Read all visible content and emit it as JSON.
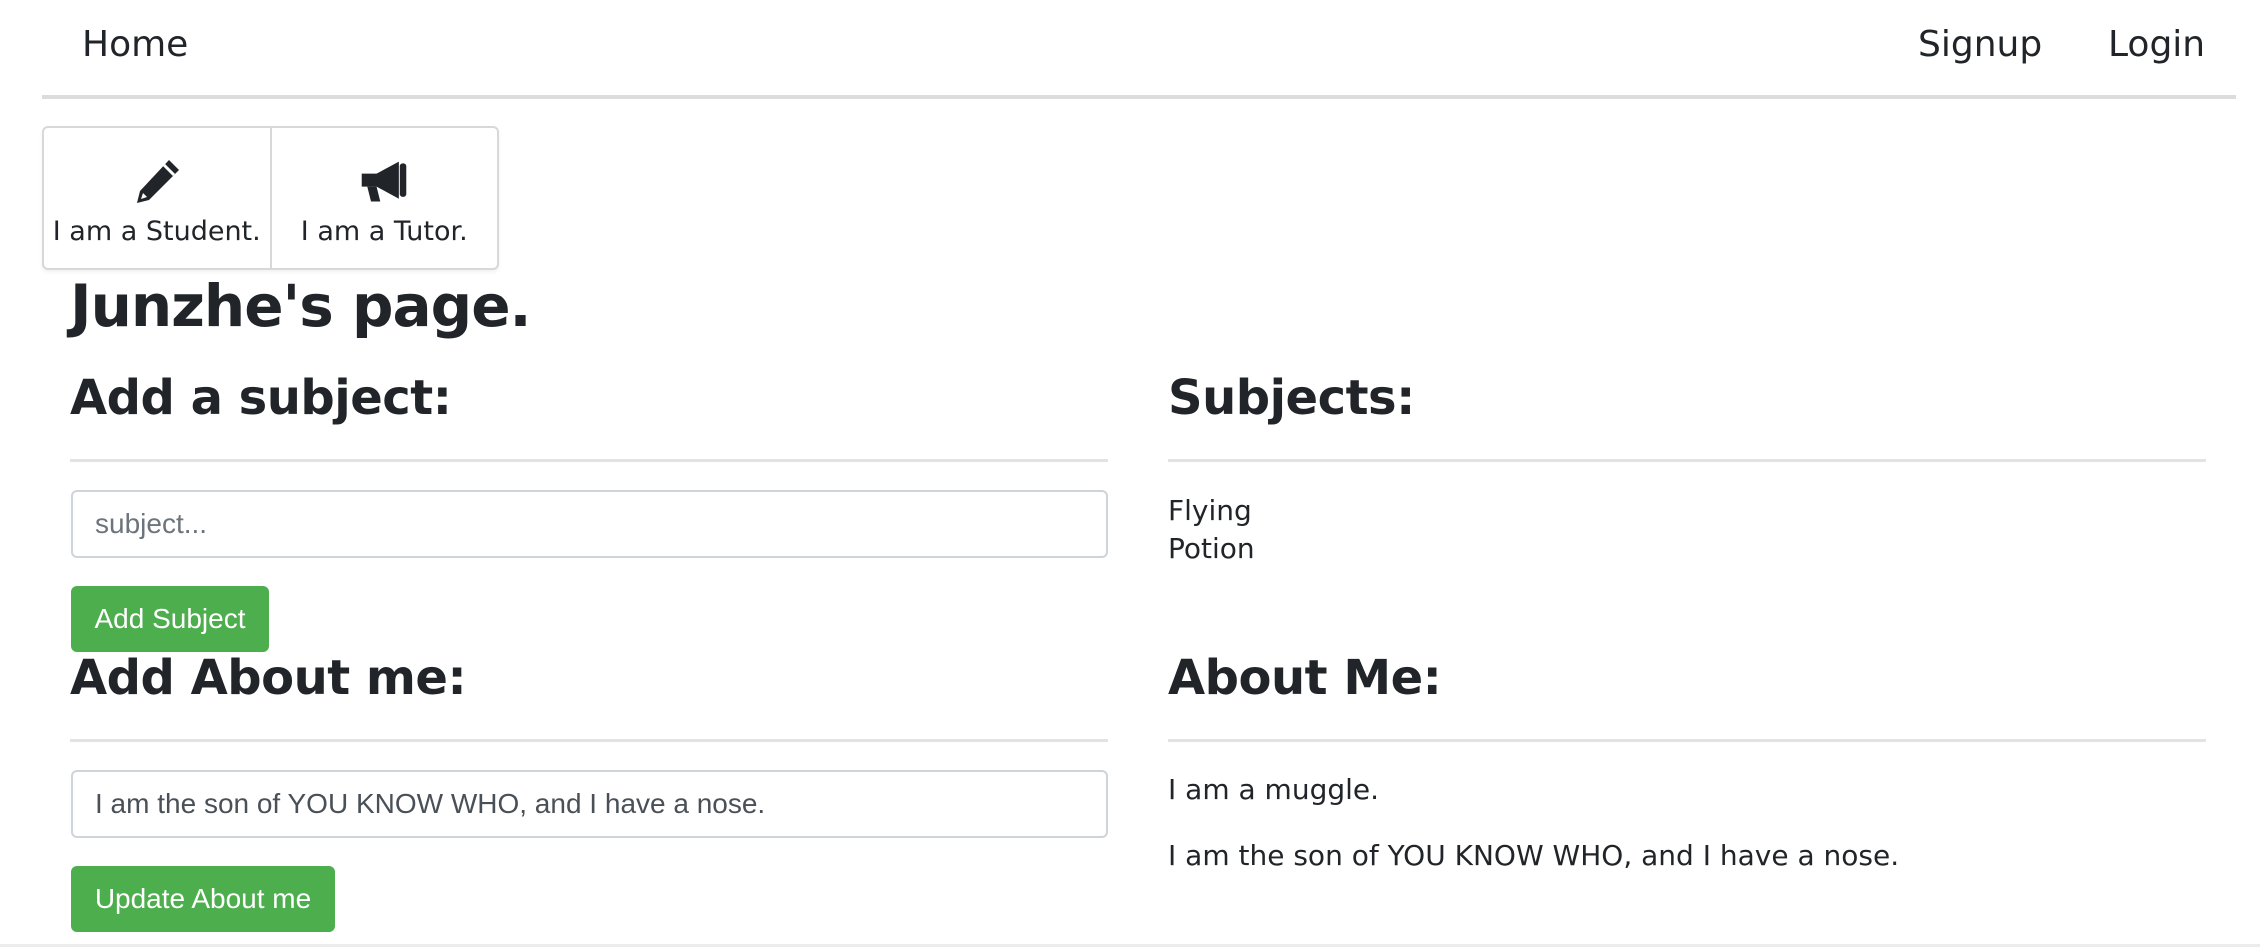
{
  "nav": {
    "home": "Home",
    "signup": "Signup",
    "login": "Login"
  },
  "roles": [
    {
      "label": "I am a Student.",
      "icon": "pencil-icon"
    },
    {
      "label": "I am a Tutor.",
      "icon": "megaphone-icon"
    }
  ],
  "page_title": "Junzhe's page.",
  "add_subject": {
    "heading": "Add a subject:",
    "placeholder": "subject...",
    "button": "Add Subject"
  },
  "subjects": {
    "heading": "Subjects:",
    "items": [
      "Flying",
      "Potion"
    ]
  },
  "add_about": {
    "heading": "Add About me:",
    "value": "I am the son of YOU KNOW WHO, and I have a nose.",
    "button": "Update About me"
  },
  "about": {
    "heading": "About Me:",
    "lines": [
      "I am a muggle.",
      "I am the son of YOU KNOW WHO, and I have a nose."
    ]
  },
  "colors": {
    "button_bg": "#4cae4c",
    "text": "#212529"
  }
}
